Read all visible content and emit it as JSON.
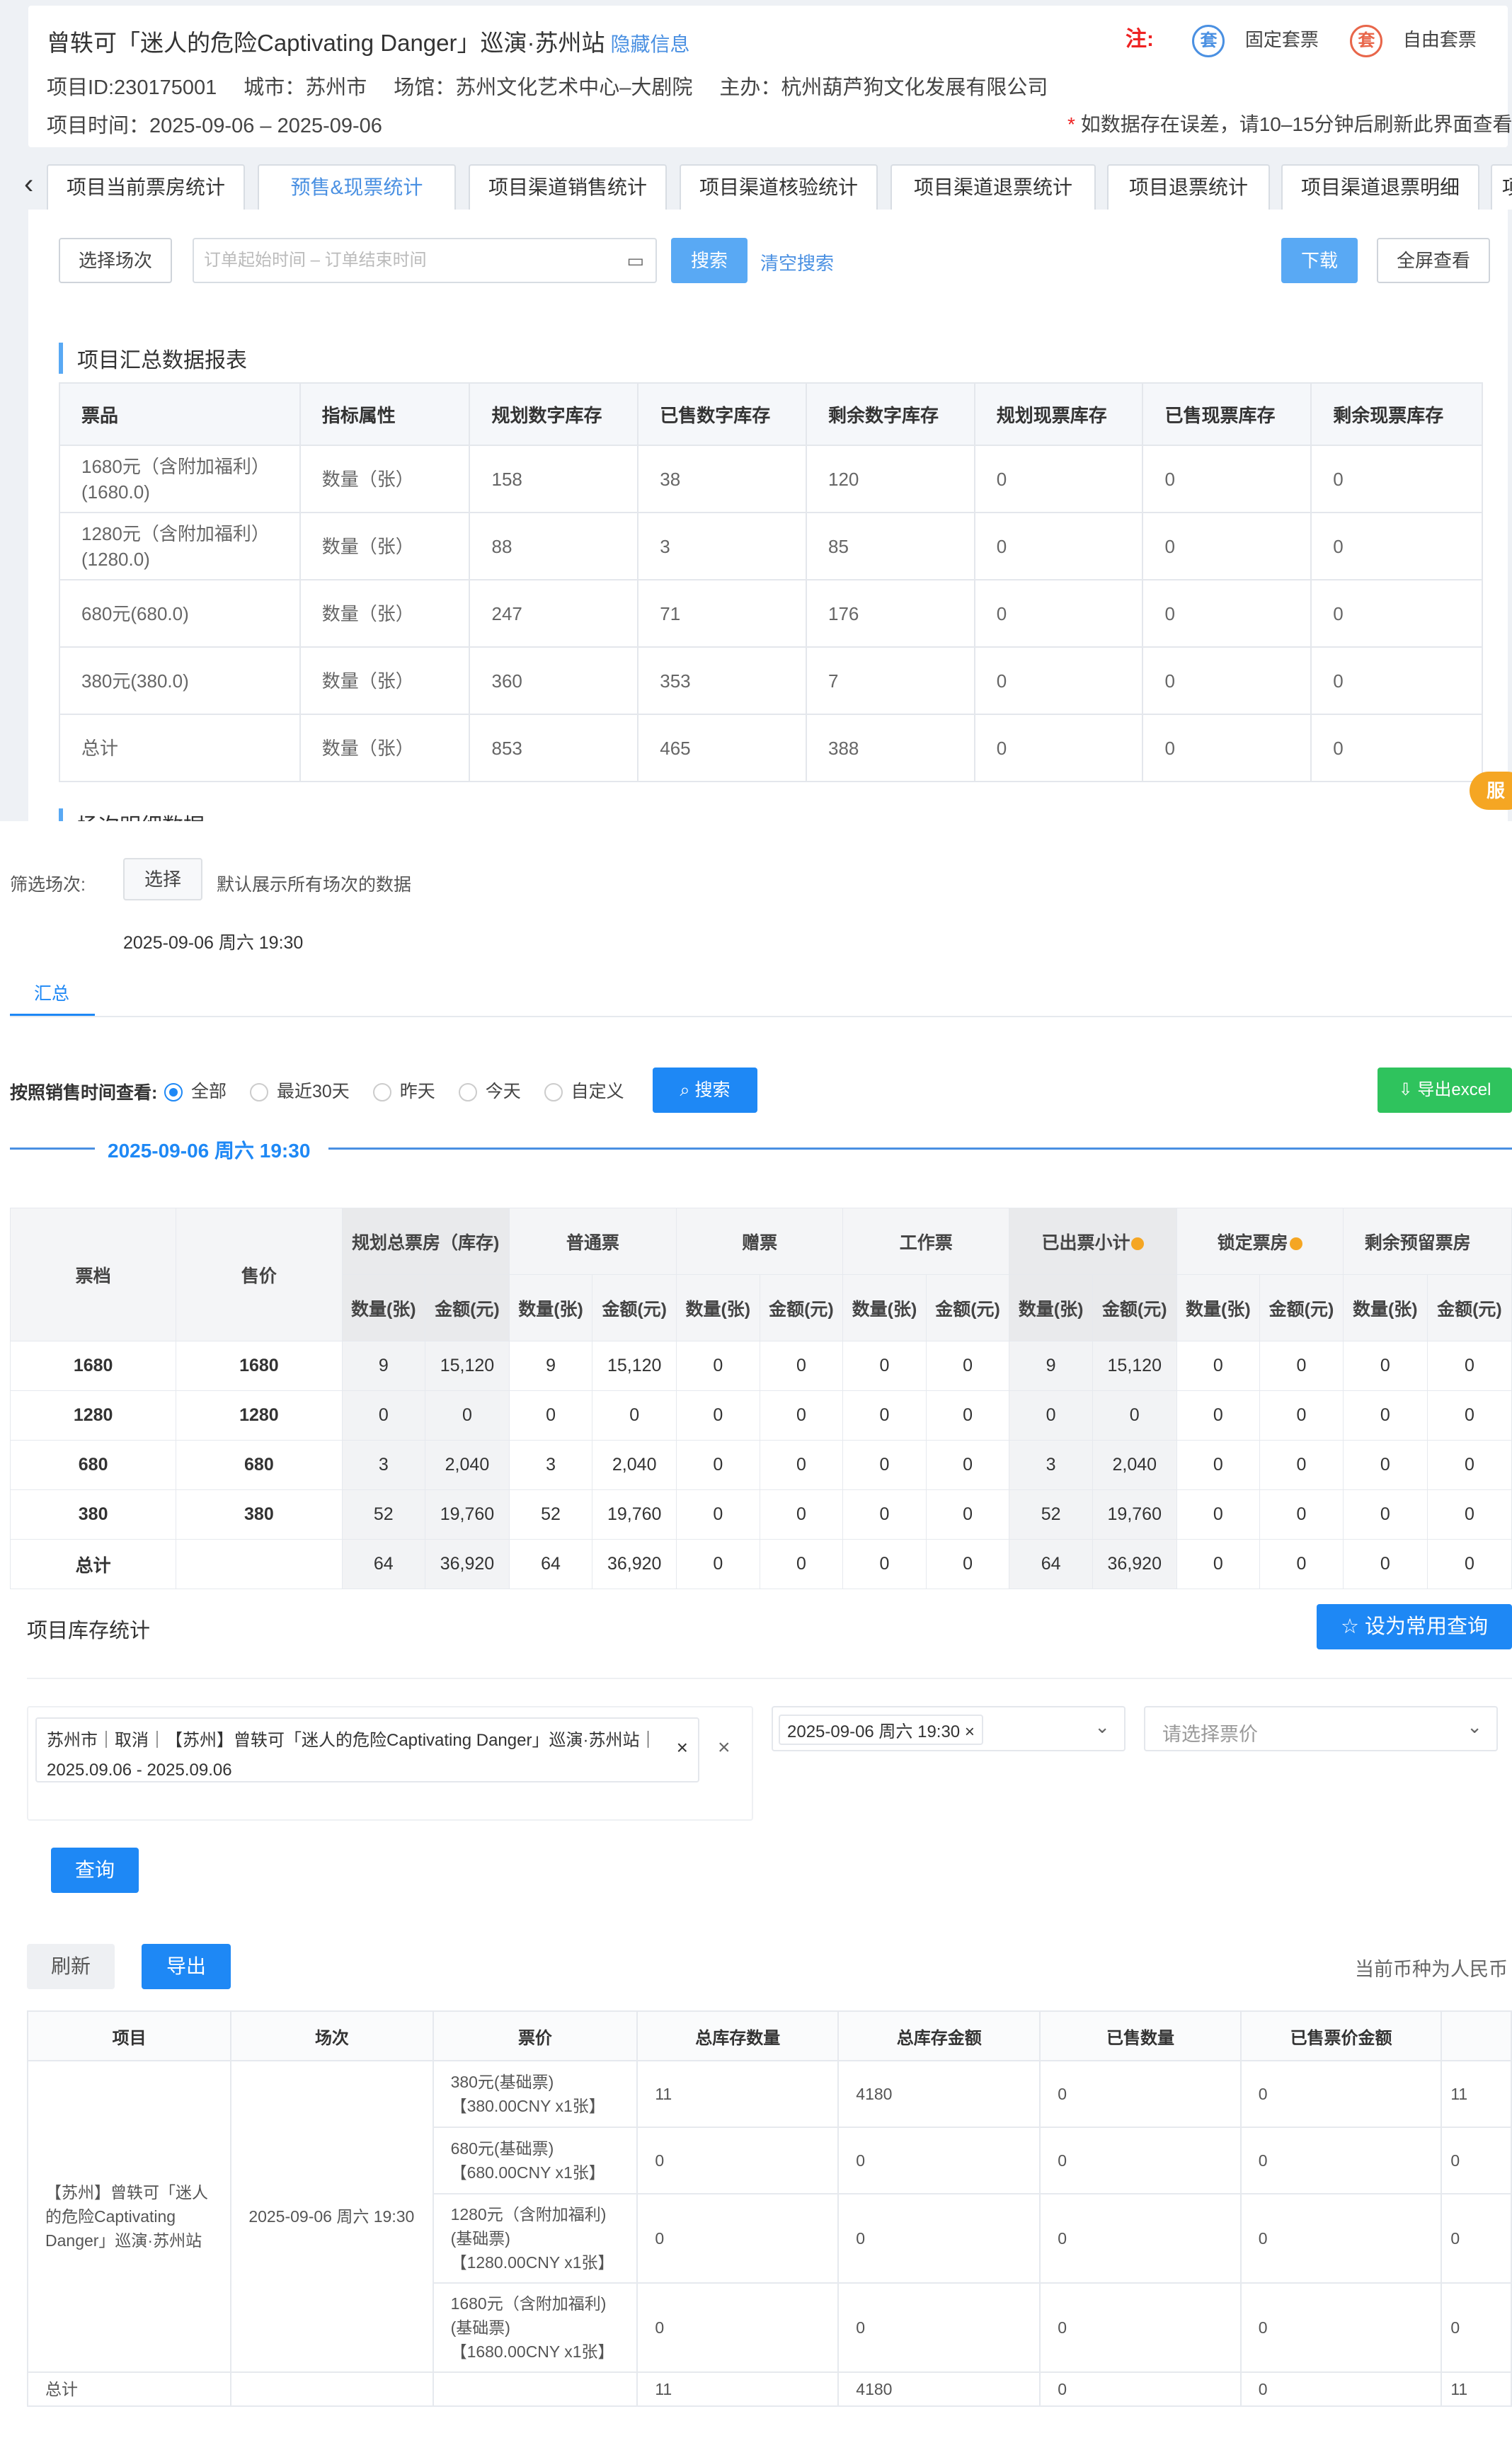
{
  "header": {
    "title": "曾轶可「迷人的危险Captivating Danger」巡演·苏州站",
    "hide_link": "隐藏信息",
    "note_label": "注:",
    "badge_fixed": "套",
    "badge_fixed_label": "固定套票",
    "badge_free": "套",
    "badge_free_label": "自由套票",
    "project_id": "项目ID:230175001",
    "city": "城市：苏州市",
    "venue": "场馆：苏州文化艺术中心–大剧院",
    "organizer": "主办：杭州葫芦狗文化发展有限公司",
    "project_time": "项目时间：2025-09-06 – 2025-09-06",
    "warning_star": "*",
    "warning": "如数据存在误差，请10–15分钟后刷新此界面查看"
  },
  "tabs": [
    "项目当前票房统计",
    "预售&现票统计",
    "项目渠道销售统计",
    "项目渠道核验统计",
    "项目渠道退票统计",
    "项目退票统计",
    "项目渠道退票明细",
    "项"
  ],
  "toolbar": {
    "select_session": "选择场次",
    "date_placeholder": "订单起始时间 – 订单结束时间",
    "search": "搜索",
    "clear": "清空搜索",
    "download": "下载",
    "fullscreen": "全屏查看"
  },
  "summary": {
    "title": "项目汇总数据报表",
    "headers": [
      "票品",
      "指标属性",
      "规划数字库存",
      "已售数字库存",
      "剩余数字库存",
      "规划现票库存",
      "已售现票库存",
      "剩余现票库存"
    ],
    "rows": [
      [
        "1680元（含附加福利）(1680.0)",
        "数量（张）",
        "158",
        "38",
        "120",
        "0",
        "0",
        "0"
      ],
      [
        "1280元（含附加福利）(1280.0)",
        "数量（张）",
        "88",
        "3",
        "85",
        "0",
        "0",
        "0"
      ],
      [
        "680元(680.0)",
        "数量（张）",
        "247",
        "71",
        "176",
        "0",
        "0",
        "0"
      ],
      [
        "380元(380.0)",
        "数量（张）",
        "360",
        "353",
        "7",
        "0",
        "0",
        "0"
      ],
      [
        "总计",
        "数量（张）",
        "853",
        "465",
        "388",
        "0",
        "0",
        "0"
      ]
    ],
    "next_title": "场次明细数据",
    "fab": "服"
  },
  "session": {
    "filter_label": "筛选场次:",
    "select": "选择",
    "default_text": "默认展示所有场次的数据",
    "date": "2025-09-06 周六 19:30",
    "tab": "汇总",
    "by_time_label": "按照销售时间查看:",
    "radios": [
      "全部",
      "最近30天",
      "昨天",
      "今天",
      "自定义"
    ],
    "search": "搜索",
    "export": "导出excel",
    "divider_date": "2025-09-06 周六 19:30",
    "col_level": "票档",
    "col_price": "售价",
    "groups": [
      "规划总票房（库存)",
      "普通票",
      "赠票",
      "工作票",
      "已出票小计",
      "锁定票房",
      "剩余预留票房"
    ],
    "sub_qty": "数量(张)",
    "sub_amt": "金额(元)",
    "rows": [
      [
        "1680",
        "1680",
        "9",
        "15,120",
        "9",
        "15,120",
        "0",
        "0",
        "0",
        "0",
        "9",
        "15,120",
        "0",
        "0",
        "0",
        "0"
      ],
      [
        "1280",
        "1280",
        "0",
        "0",
        "0",
        "0",
        "0",
        "0",
        "0",
        "0",
        "0",
        "0",
        "0",
        "0",
        "0",
        "0"
      ],
      [
        "680",
        "680",
        "3",
        "2,040",
        "3",
        "2,040",
        "0",
        "0",
        "0",
        "0",
        "3",
        "2,040",
        "0",
        "0",
        "0",
        "0"
      ],
      [
        "380",
        "380",
        "52",
        "19,760",
        "52",
        "19,760",
        "0",
        "0",
        "0",
        "0",
        "52",
        "19,760",
        "0",
        "0",
        "0",
        "0"
      ],
      [
        "总计",
        "",
        "64",
        "36,920",
        "64",
        "36,920",
        "0",
        "0",
        "0",
        "0",
        "64",
        "36,920",
        "0",
        "0",
        "0",
        "0"
      ]
    ]
  },
  "inventory": {
    "title": "项目库存统计",
    "fav": "设为常用查询",
    "project_tag": "苏州市｜取消｜【苏州】曾轶可「迷人的危险Captivating Danger」巡演·苏州站｜2025.09.06 - 2025.09.06",
    "session_tag": "2025-09-06 周六 19:30",
    "price_placeholder": "请选择票价",
    "query": "查询",
    "refresh": "刷新",
    "export": "导出",
    "currency": "当前币种为人民币"
  },
  "detail": {
    "headers": [
      "项目",
      "场次",
      "票价",
      "总库存数量",
      "总库存金额",
      "已售数量",
      "已售票价金额",
      ""
    ],
    "project": "【苏州】曾轶可「迷人的危险Captivating Danger」巡演·苏州站",
    "session": "2025-09-06 周六 19:30",
    "rows": [
      [
        "380元(基础票)【380.00CNY x1张】",
        "11",
        "4180",
        "0",
        "0",
        "11"
      ],
      [
        "680元(基础票)【680.00CNY x1张】",
        "0",
        "0",
        "0",
        "0",
        "0"
      ],
      [
        "1280元（含附加福利)(基础票)【1280.00CNY x1张】",
        "0",
        "0",
        "0",
        "0",
        "0"
      ],
      [
        "1680元（含附加福利)(基础票)【1680.00CNY x1张】",
        "0",
        "0",
        "0",
        "0",
        "0"
      ]
    ],
    "total_label": "总计",
    "total": [
      "11",
      "4180",
      "0",
      "0",
      "11"
    ]
  },
  "colors": {
    "accent": "#1e88f5",
    "tab_active": "#4a90e2",
    "danger": "#e22222",
    "export_green": "#2fc35d",
    "dot": "#f5a623"
  }
}
